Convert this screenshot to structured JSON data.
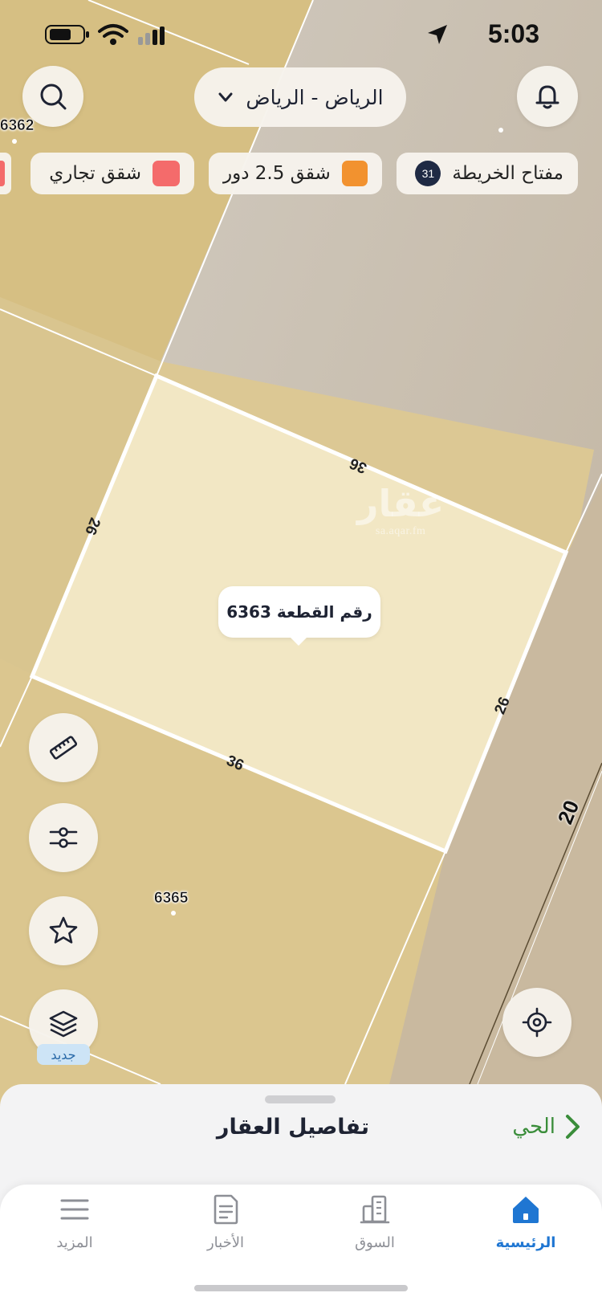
{
  "status_bar": {
    "time": "5:03"
  },
  "header": {
    "city_selector": "الرياض - الرياض"
  },
  "legend_chips": [
    {
      "label": "مفتاح الخريطة",
      "count": "31"
    },
    {
      "label": "شقق 2.5 دور",
      "color": "#f2922f"
    },
    {
      "label": "شقق تجاري",
      "color": "#f46b6b"
    }
  ],
  "map": {
    "selected_plot_label": "رقم القطعة 6363",
    "edge_lengths": {
      "top": "36",
      "bottom": "36",
      "left": "26",
      "right": "26"
    },
    "neighbor_parcels": [
      "6362",
      "6365"
    ],
    "road_width": "20",
    "watermark": {
      "brand": "عقار",
      "site": "sa.aqar.fm"
    },
    "colors": {
      "selected_parcel": "#f2e7c4",
      "residential_zone": "#dcc894",
      "road": "#cfc6b7"
    }
  },
  "map_tools": {
    "new_badge": "جديد"
  },
  "sheet": {
    "title": "تفاصيل العقار",
    "neighborhood_link": "الحي"
  },
  "tabbar": {
    "items": [
      {
        "label": "الرئيسية",
        "icon": "home-icon",
        "active": true
      },
      {
        "label": "السوق",
        "icon": "building-icon",
        "active": false
      },
      {
        "label": "الأخبار",
        "icon": "news-icon",
        "active": false
      },
      {
        "label": "المزيد",
        "icon": "menu-icon",
        "active": false
      }
    ]
  },
  "accent_color": "#1f76d2"
}
